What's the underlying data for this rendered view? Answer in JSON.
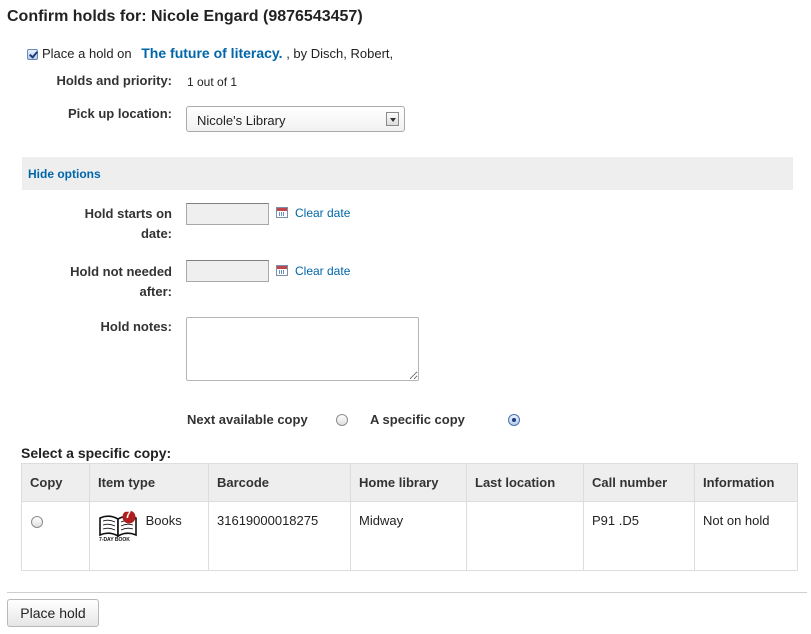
{
  "header": {
    "title": "Confirm holds for: Nicole Engard (9876543457)"
  },
  "hold": {
    "place_prefix": "Place a hold on",
    "book_title": "The future of literacy.",
    "author_suffix": ", by Disch, Robert,",
    "priority_label": "Holds and priority:",
    "priority_value": "1 out of 1",
    "pickup_label": "Pick up location:",
    "pickup_value": "Nicole's Library"
  },
  "options": {
    "toggle_label": "Hide options",
    "start_label_1": "Hold starts on",
    "start_label_2": "date:",
    "expire_label_1": "Hold not needed",
    "expire_label_2": "after:",
    "clear_date": "Clear date",
    "notes_label": "Hold notes:",
    "start_value": "",
    "expire_value": "",
    "notes_value": ""
  },
  "copy_choice": {
    "next_available": "Next available copy",
    "specific": "A specific copy",
    "selected": "specific",
    "section_title": "Select a specific copy:"
  },
  "table": {
    "headers": [
      "Copy",
      "Item type",
      "Barcode",
      "Home library",
      "Last location",
      "Call number",
      "Information"
    ],
    "rows": [
      {
        "item_type": "Books",
        "icon_badge": "7",
        "icon_caption": "7-DAY BOOK",
        "barcode": "31619000018275",
        "home_library": "Midway",
        "last_location": "",
        "call_number": "P91 .D5",
        "information": "Not on hold"
      }
    ]
  },
  "actions": {
    "place_hold": "Place hold"
  },
  "colors": {
    "link": "#0066aa",
    "header_bg": "#eeeeee",
    "badge_red": "#b01e1e"
  }
}
